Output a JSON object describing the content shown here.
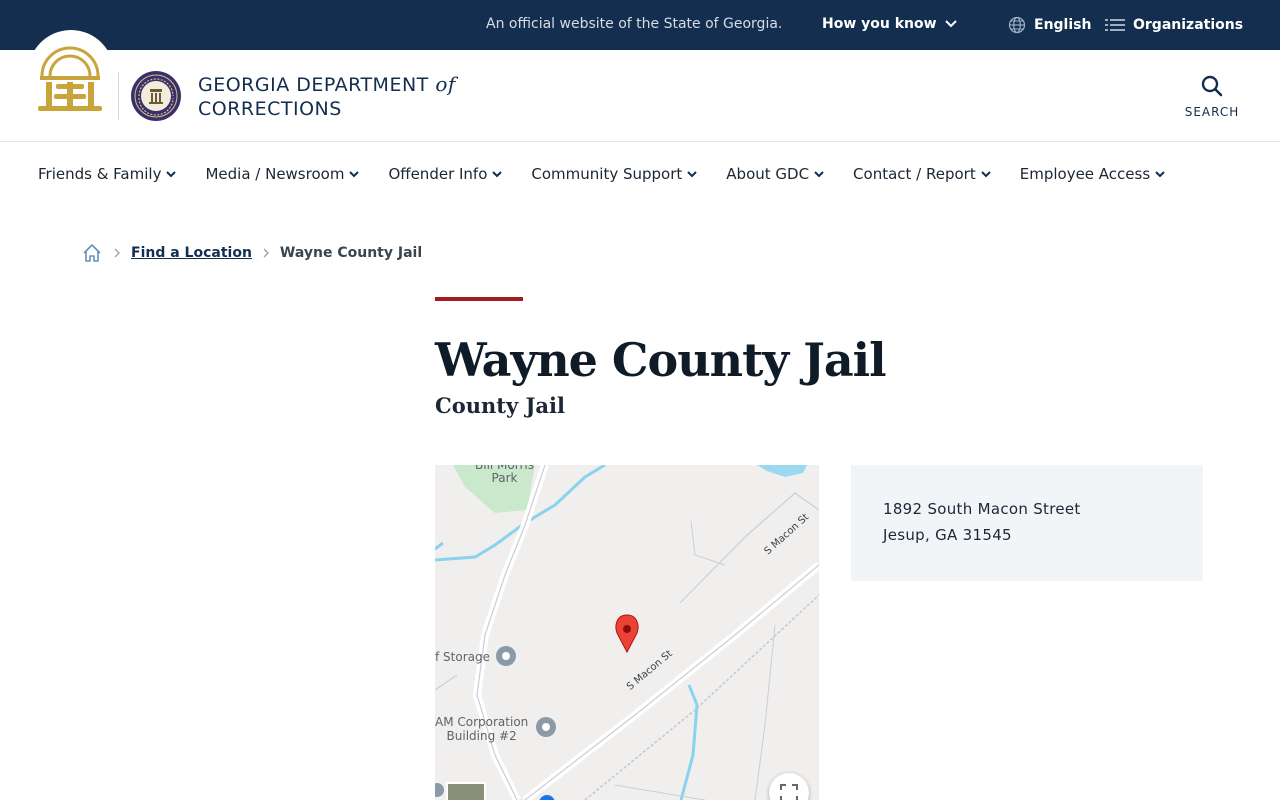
{
  "topbar": {
    "official_text": "An official website of the State of Georgia.",
    "how_you_know": "How you know",
    "language": "English",
    "organizations": "Organizations"
  },
  "header": {
    "dept_name_line1": "GEORGIA DEPARTMENT",
    "dept_name_of": "of",
    "dept_name_line2": "CORRECTIONS",
    "search_label": "SEARCH"
  },
  "nav": {
    "items": [
      {
        "label": "Friends & Family"
      },
      {
        "label": "Media / Newsroom"
      },
      {
        "label": "Offender Info"
      },
      {
        "label": "Community Support"
      },
      {
        "label": "About GDC"
      },
      {
        "label": "Contact / Report"
      },
      {
        "label": "Employee Access"
      }
    ]
  },
  "breadcrumb": {
    "link": "Find a Location",
    "current": "Wayne County Jail"
  },
  "page": {
    "title": "Wayne County Jail",
    "subtitle": "County Jail"
  },
  "map": {
    "labels": {
      "park": "Bill Morris\nPark",
      "storage": "f Storage",
      "corp": "AM Corporation\nBuilding #2",
      "street_upper": "S Macon St",
      "street_lower": "S Macon St"
    }
  },
  "address": {
    "line1": "1892 South Macon Street",
    "line2": "Jesup, GA 31545"
  },
  "colors": {
    "topbar_bg": "#132e4e",
    "accent_red": "#a11d22",
    "gold": "#c9a43a"
  }
}
